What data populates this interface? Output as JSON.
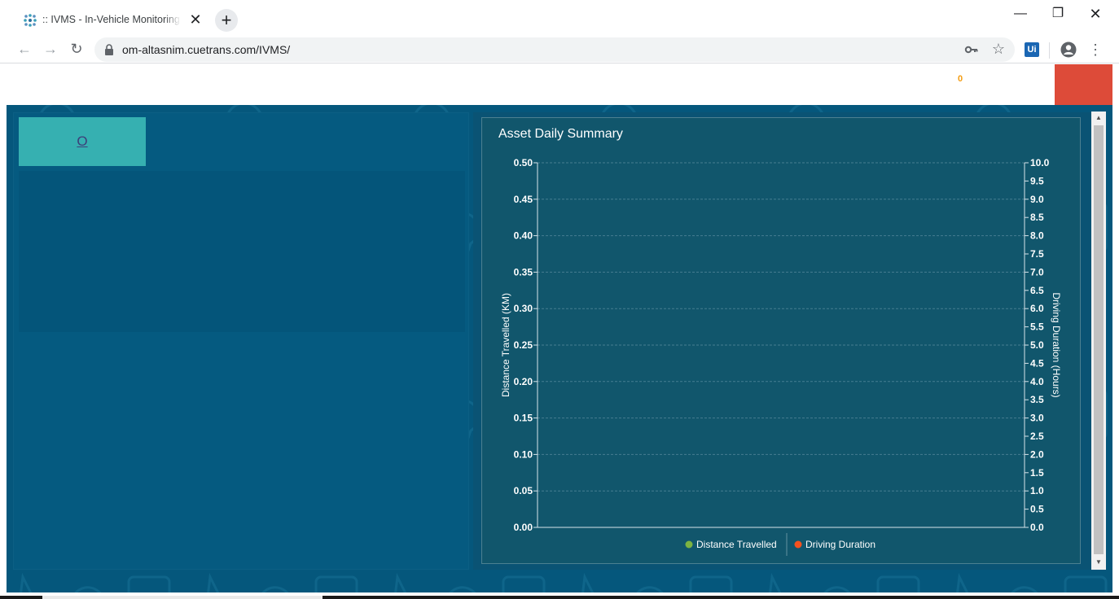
{
  "browser": {
    "tab_title": ":: IVMS - In-Vehicle Monitoring System",
    "url": "om-altasnim.cuetrans.com/IVMS/",
    "extension_label": "Ui"
  },
  "header": {
    "notification_count": "0",
    "accent_color": "#dd4b39"
  },
  "left_panel": {
    "tile_label": "O",
    "tile_color": "#36b0b1"
  },
  "chart_panel": {
    "title": "Asset Daily Summary"
  },
  "chart_data": {
    "type": "line",
    "title": "Asset Daily Summary",
    "ylabel": "Distance Travelled (KM)",
    "y2label": "Driving Duration (Hours)",
    "ylim": [
      0,
      0.5
    ],
    "y2lim": [
      0,
      10
    ],
    "yticks": [
      "0.00",
      "0.05",
      "0.10",
      "0.15",
      "0.20",
      "0.25",
      "0.30",
      "0.35",
      "0.40",
      "0.45",
      "0.50"
    ],
    "y2ticks": [
      "0.0",
      "0.5",
      "1.0",
      "1.5",
      "2.0",
      "2.5",
      "3.0",
      "3.5",
      "4.0",
      "4.5",
      "5.0",
      "5.5",
      "6.0",
      "6.5",
      "7.0",
      "7.5",
      "8.0",
      "8.5",
      "9.0",
      "9.5",
      "10.0"
    ],
    "grid": true,
    "legend_position": "bottom",
    "series": [
      {
        "name": "Distance Travelled",
        "color": "#7cb342",
        "values": []
      },
      {
        "name": "Driving Duration",
        "color": "#f4511e",
        "values": []
      }
    ]
  }
}
